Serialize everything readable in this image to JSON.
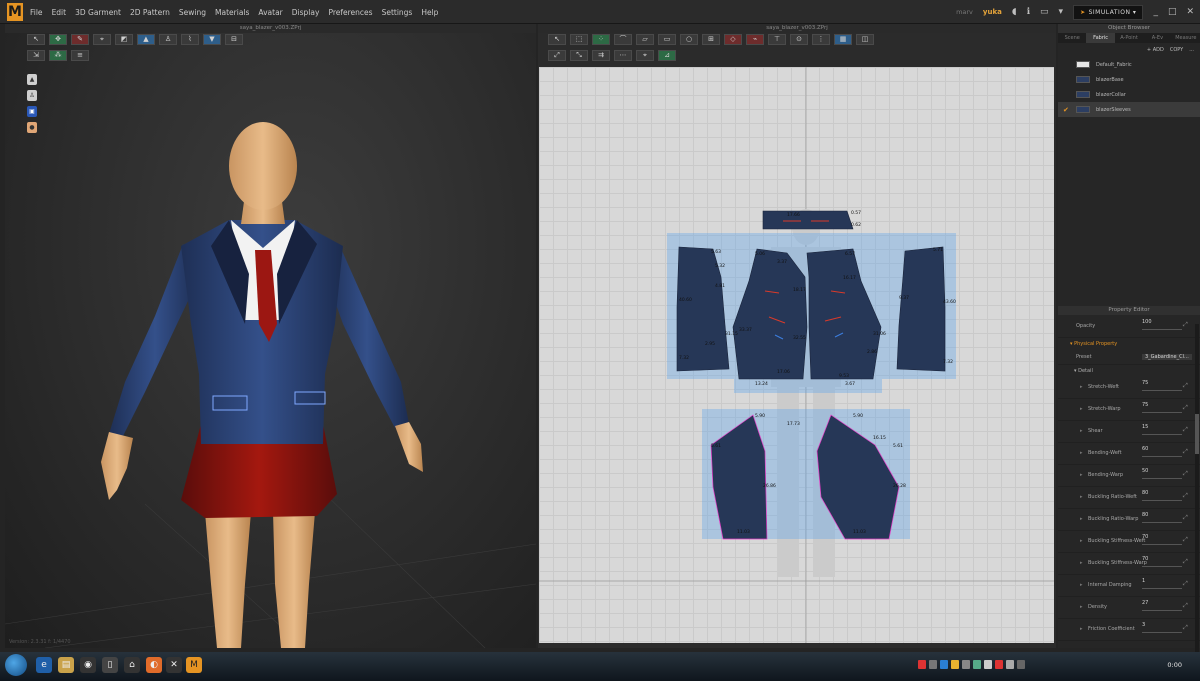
{
  "app": {
    "logo": "M",
    "menu": [
      "File",
      "Edit",
      "3D Garment",
      "2D Pattern",
      "Sewing",
      "Materials",
      "Avatar",
      "Display",
      "Preferences",
      "Settings",
      "Help"
    ],
    "user_prefix": "marv",
    "user": "yuka",
    "simulation_label": "SIMULATION",
    "accent_color": "#e59423"
  },
  "view3d": {
    "title": "saya_blazer_v003.ZPrj",
    "status": "Version: 2.3.31    f: 1/4470"
  },
  "view2d": {
    "title": "saya_blazer_v003.ZPrj",
    "measurements": {
      "collar": [
        "17.66",
        "0.57",
        "0.62"
      ],
      "back_left": [
        "5.63",
        "5.32",
        "4.81",
        "40.60",
        "31.15",
        "2.95",
        "7.32"
      ],
      "front_left": [
        "5.06",
        "3.37",
        "18.17",
        "33.37",
        "32.55",
        "17.06",
        "13.24"
      ],
      "front_right": [
        "6.57",
        "16.17",
        "31.06",
        "2.86",
        "9.53",
        "3.67"
      ],
      "back_right": [
        "5.71",
        "9.37",
        "43.60",
        "7.32"
      ],
      "sleeve_left": [
        "5.90",
        "17.73",
        "5.61",
        "26.86",
        "11.03"
      ],
      "sleeve_right": [
        "5.90",
        "16.15",
        "5.61",
        "26.28",
        "11.03"
      ]
    }
  },
  "object_browser": {
    "title": "Object Browser",
    "tabs": [
      "Scene",
      "Fabric",
      "A-Point",
      "A-Ev",
      "Measure"
    ],
    "active_tab": "Fabric",
    "actions": [
      "+ ADD",
      "COPY",
      "..."
    ],
    "fabrics": [
      {
        "name": "Default_Fabric",
        "color": "#e6e6e6",
        "selected": false
      },
      {
        "name": "blazerBase",
        "color": "#2c3e62",
        "selected": false
      },
      {
        "name": "blazerCollar",
        "color": "#2c3e62",
        "selected": false
      },
      {
        "name": "blazerSleeves",
        "color": "#2c3e62",
        "selected": true
      }
    ]
  },
  "property_editor": {
    "title": "Property Editor",
    "opacity_label": "Opacity",
    "opacity_value": "100",
    "physical_property": "Physical Property",
    "preset_label": "Preset",
    "preset_value": "3_Gabardine_Cl...",
    "detail": "Detail",
    "rows": [
      {
        "label": "Stretch-Weft",
        "value": "75"
      },
      {
        "label": "Stretch-Warp",
        "value": "75"
      },
      {
        "label": "Shear",
        "value": "15"
      },
      {
        "label": "Bending-Weft",
        "value": "60"
      },
      {
        "label": "Bending-Warp",
        "value": "50"
      },
      {
        "label": "Buckling Ratio-Weft",
        "value": "80"
      },
      {
        "label": "Buckling Ratio-Warp",
        "value": "80"
      },
      {
        "label": "Buckling Stiffness-Weft",
        "value": "70"
      },
      {
        "label": "Buckling Stiffness-Warp",
        "value": "70"
      },
      {
        "label": "Internal Damping",
        "value": "1"
      },
      {
        "label": "Density",
        "value": "27"
      },
      {
        "label": "Friction Coefficient",
        "value": "3"
      }
    ]
  },
  "taskbar": {
    "clock": "0:00"
  }
}
